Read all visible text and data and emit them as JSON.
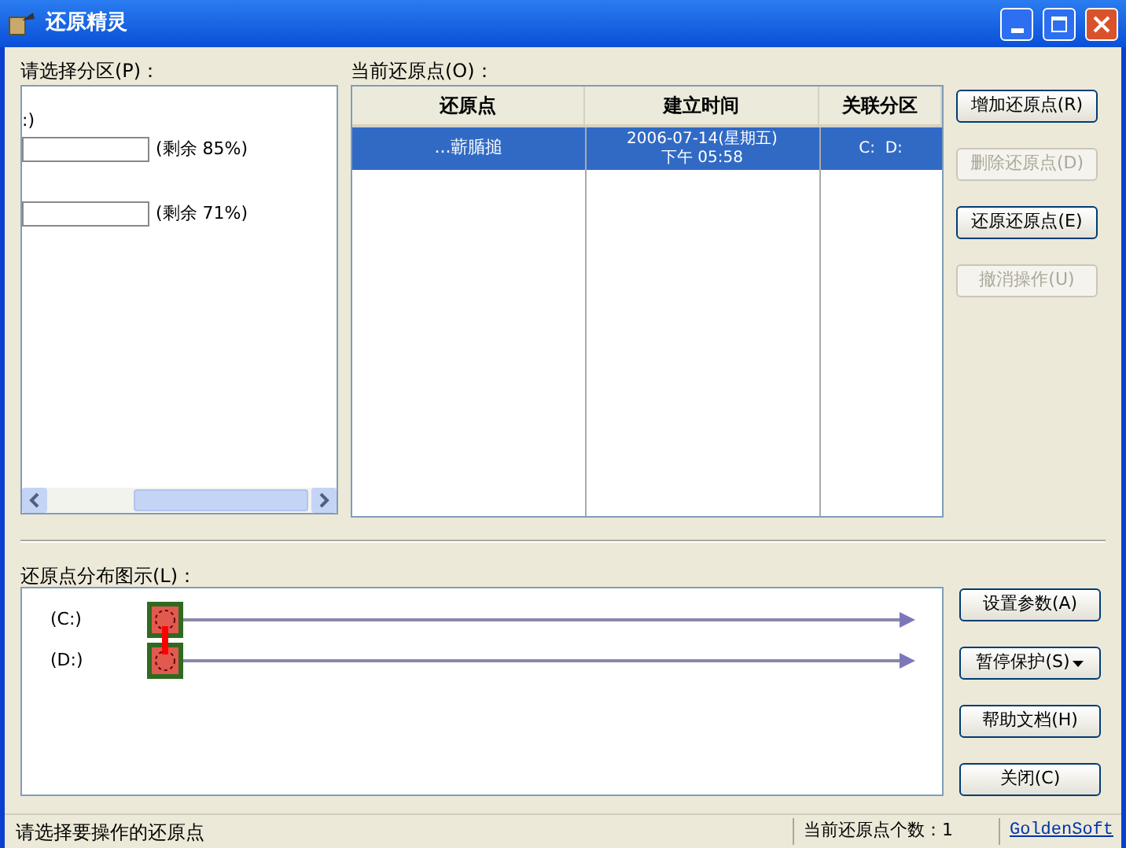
{
  "window": {
    "title": "还原精灵"
  },
  "partitions": {
    "label": "请选择分区(P)：",
    "items": [
      {
        "name": ":)",
        "free": "(剩余 85%)"
      },
      {
        "free": "(剩余 71%)"
      }
    ]
  },
  "restore_points": {
    "label": "当前还原点(O)：",
    "columns": [
      "还原点",
      "建立时间",
      "关联分区"
    ],
    "rows": [
      {
        "selected": true,
        "name": "...蘄腯搥",
        "time": [
          "2006-07-14(星期五)",
          "下午 05:58"
        ],
        "partitions": "C:  D:"
      }
    ]
  },
  "top_buttons": [
    {
      "label": "增加还原点(R)",
      "disabled": false,
      "kind": "plain"
    },
    {
      "label": "删除还原点(D)",
      "disabled": true,
      "kind": "plain"
    },
    {
      "label": "还原还原点(E)",
      "disabled": false,
      "kind": "plain"
    },
    {
      "label": "撤消操作(U)",
      "disabled": true,
      "kind": "plain"
    }
  ],
  "distribution": {
    "label": "还原点分布图示(L)：",
    "drives": [
      {
        "label": "(C:)"
      },
      {
        "label": "(D:)"
      }
    ]
  },
  "bottom_buttons": [
    {
      "label": "设置参数(A)",
      "disabled": false,
      "kind": "plain"
    },
    {
      "label": "暂停保护(S)",
      "disabled": false,
      "kind": "dropdown"
    },
    {
      "label": "帮助文档(H)",
      "disabled": false,
      "kind": "plain"
    },
    {
      "label": "关闭(C)",
      "disabled": false,
      "kind": "plain"
    }
  ],
  "status_bar": {
    "message": "请选择要操作的还原点",
    "count": "当前还原点个数：1",
    "link": "GoldenSoft"
  }
}
